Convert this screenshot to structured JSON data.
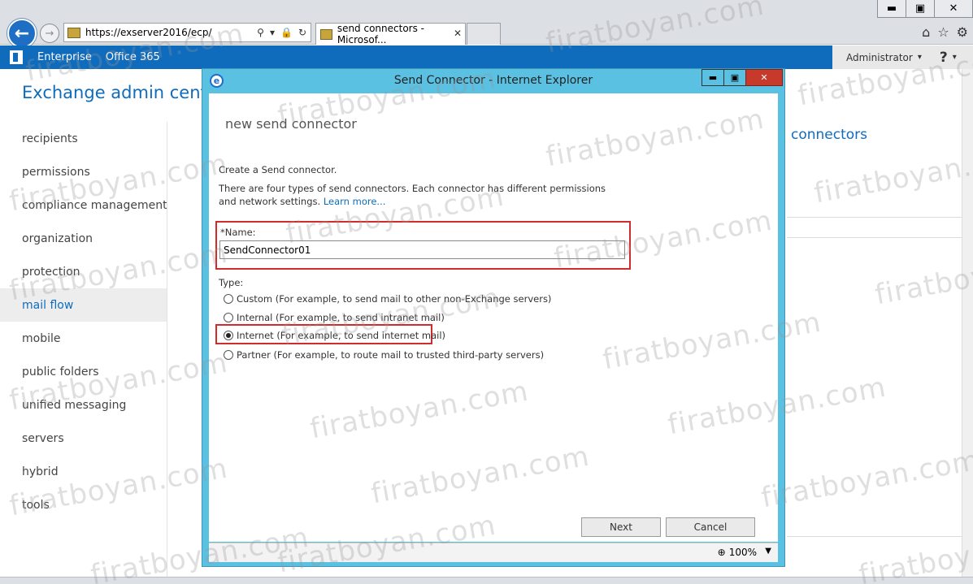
{
  "browser": {
    "address_url": "https://exserver2016/ecp/",
    "tab_title": "send connectors - Microsof...",
    "win_min": "▬",
    "win_max": "▣",
    "win_close": "✕",
    "tab_close": "✕"
  },
  "o365bar": {
    "brand": "Enterprise",
    "product": "Office 365",
    "user": "Administrator",
    "help": "?"
  },
  "eac": {
    "title": "Exchange admin center",
    "nav": [
      {
        "label": "recipients"
      },
      {
        "label": "permissions"
      },
      {
        "label": "compliance management"
      },
      {
        "label": "organization"
      },
      {
        "label": "protection"
      },
      {
        "label": "mail flow"
      },
      {
        "label": "mobile"
      },
      {
        "label": "public folders"
      },
      {
        "label": "unified messaging"
      },
      {
        "label": "servers"
      },
      {
        "label": "hybrid"
      },
      {
        "label": "tools"
      }
    ],
    "background_heading": "connectors"
  },
  "popup": {
    "window_title": "Send Connector - Internet Explorer",
    "heading": "new send connector",
    "intro": "Create a Send connector.",
    "description": "There are four types of send connectors. Each connector has different permissions and network settings.",
    "learn_more": "Learn more...",
    "name_label": "*Name:",
    "name_value": "SendConnector01",
    "type_label": "Type:",
    "types": [
      {
        "label": "Custom (For example, to send mail to other non-Exchange servers)"
      },
      {
        "label": "Internal (For example, to send intranet mail)"
      },
      {
        "label": "Internet (For example, to send internet mail)"
      },
      {
        "label": "Partner (For example, to route mail to trusted third-party servers)"
      }
    ],
    "selected_type": "Internet (For example, to send internet mail)",
    "next_label": "Next",
    "cancel_label": "Cancel",
    "zoom": "100%"
  },
  "watermark": "firatboyan.com",
  "colors": {
    "accent": "#0f6cbd",
    "popup_frame": "#5bc1e3",
    "highlight": "#d12b2b",
    "close_button": "#c7392b"
  }
}
